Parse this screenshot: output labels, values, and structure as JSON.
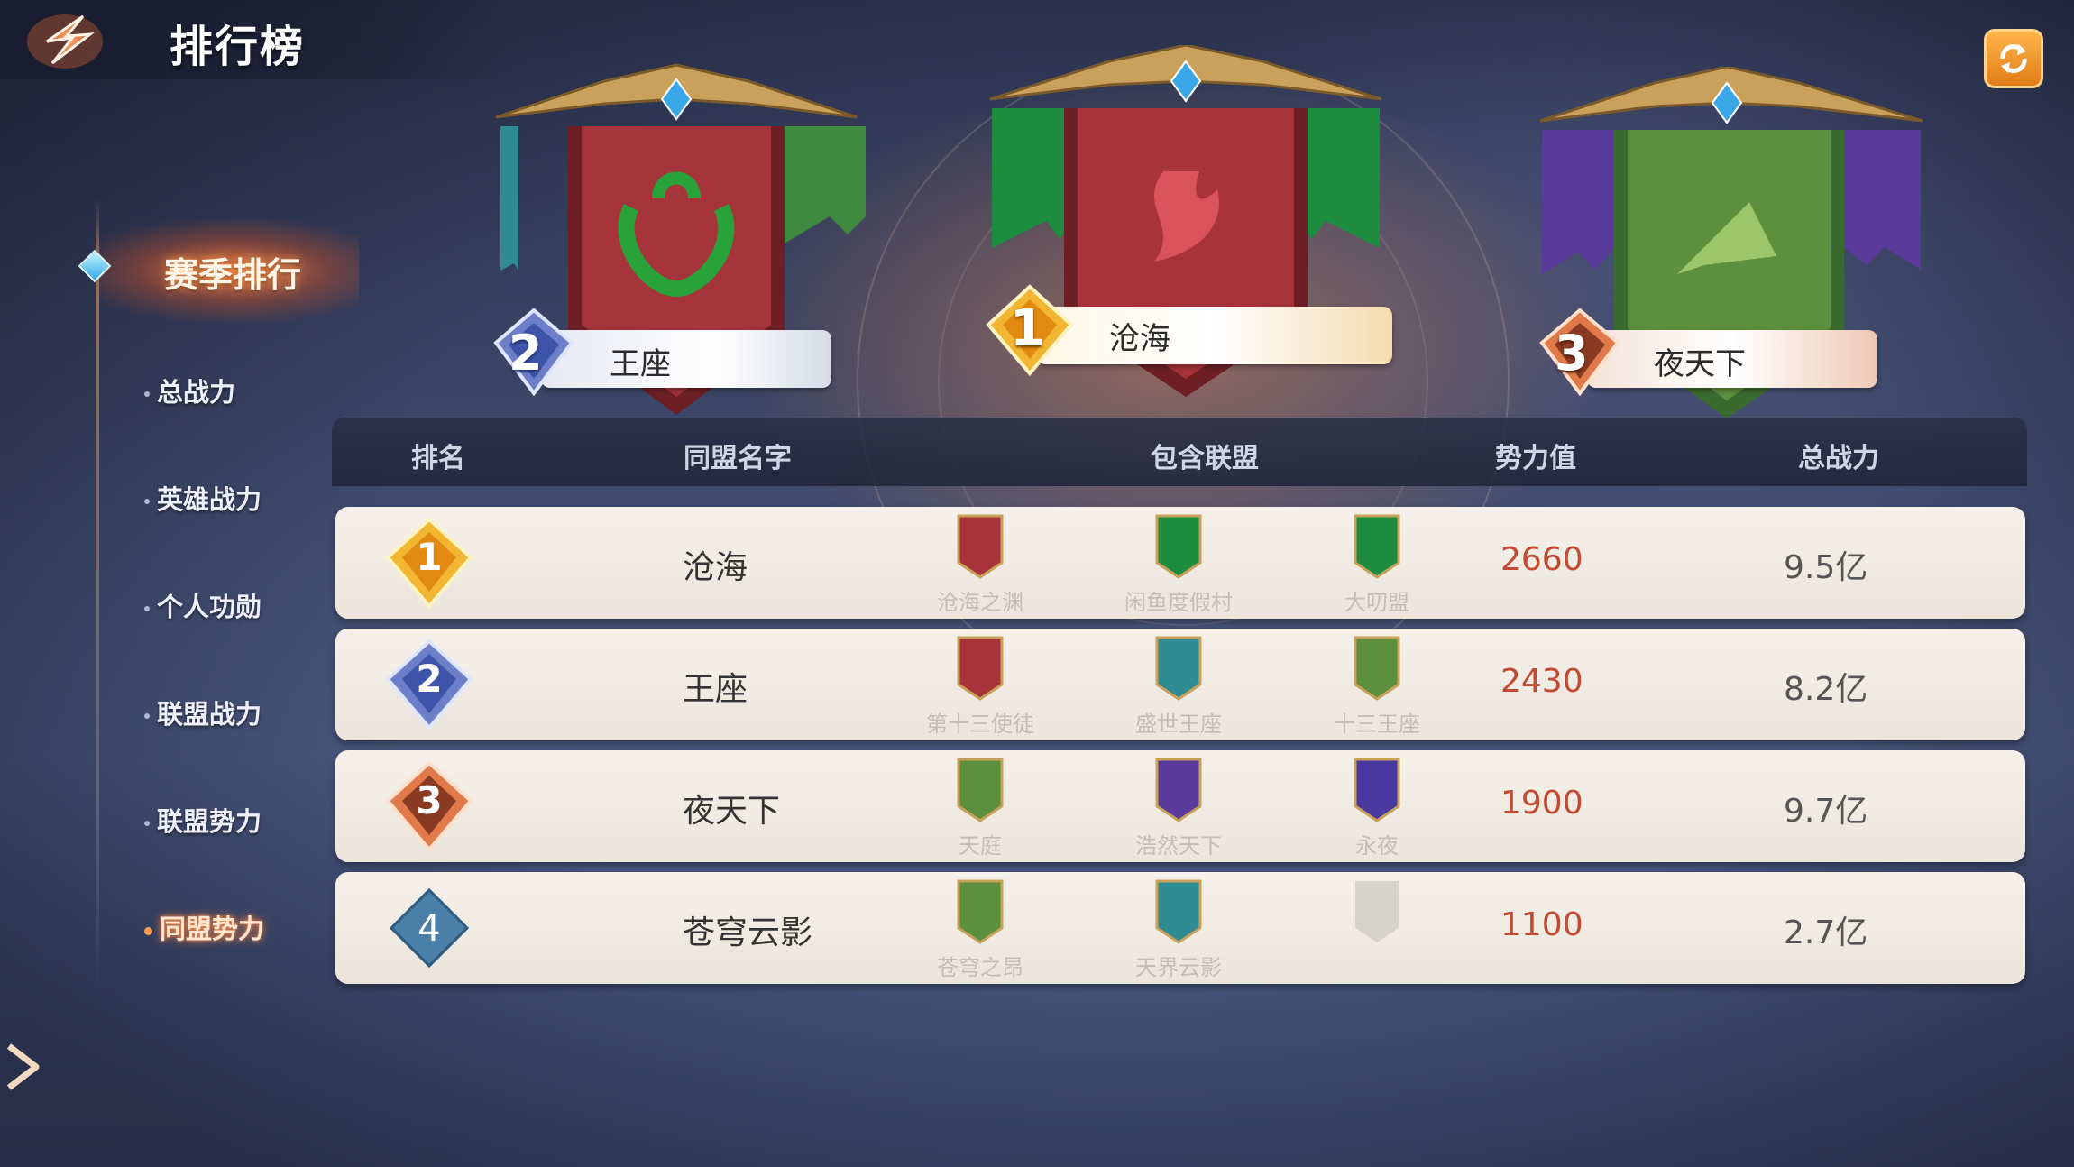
{
  "header": {
    "title": "排行榜"
  },
  "sidebar": {
    "main_tab": "赛季排行",
    "items": [
      {
        "label": "总战力",
        "active": false
      },
      {
        "label": "英雄战力",
        "active": false
      },
      {
        "label": "个人功勋",
        "active": false
      },
      {
        "label": "联盟战力",
        "active": false
      },
      {
        "label": "联盟势力",
        "active": false
      },
      {
        "label": "同盟势力",
        "active": true
      }
    ]
  },
  "podium": {
    "first": {
      "rank": "1",
      "name": "沧海"
    },
    "second": {
      "rank": "2",
      "name": "王座"
    },
    "third": {
      "rank": "3",
      "name": "夜天下"
    }
  },
  "table": {
    "headers": {
      "rank": "排名",
      "name": "同盟名字",
      "members": "包含联盟",
      "power": "势力值",
      "total": "总战力"
    },
    "rows": [
      {
        "rank": "1",
        "name": "沧海",
        "members": [
          "沧海之渊",
          "闲鱼度假村",
          "大叨盟"
        ],
        "power": "2660",
        "total": "9.5亿"
      },
      {
        "rank": "2",
        "name": "王座",
        "members": [
          "第十三使徒",
          "盛世王座",
          "十三王座"
        ],
        "power": "2430",
        "total": "8.2亿"
      },
      {
        "rank": "3",
        "name": "夜天下",
        "members": [
          "天庭",
          "浩然天下",
          "永夜"
        ],
        "power": "1900",
        "total": "9.7亿"
      },
      {
        "rank": "4",
        "name": "苍穹云影",
        "members": [
          "苍穹之昂",
          "天界云影",
          ""
        ],
        "power": "1100",
        "total": "2.7亿"
      }
    ]
  },
  "colors": {
    "accent": "#e07d17",
    "power_text": "#c24a33",
    "active_tab": "#f07a3c"
  },
  "icons": [
    "back-arrow-icon",
    "refresh-icon",
    "expand-arrow-icon",
    "banner-icon",
    "rank-badge-icon"
  ]
}
